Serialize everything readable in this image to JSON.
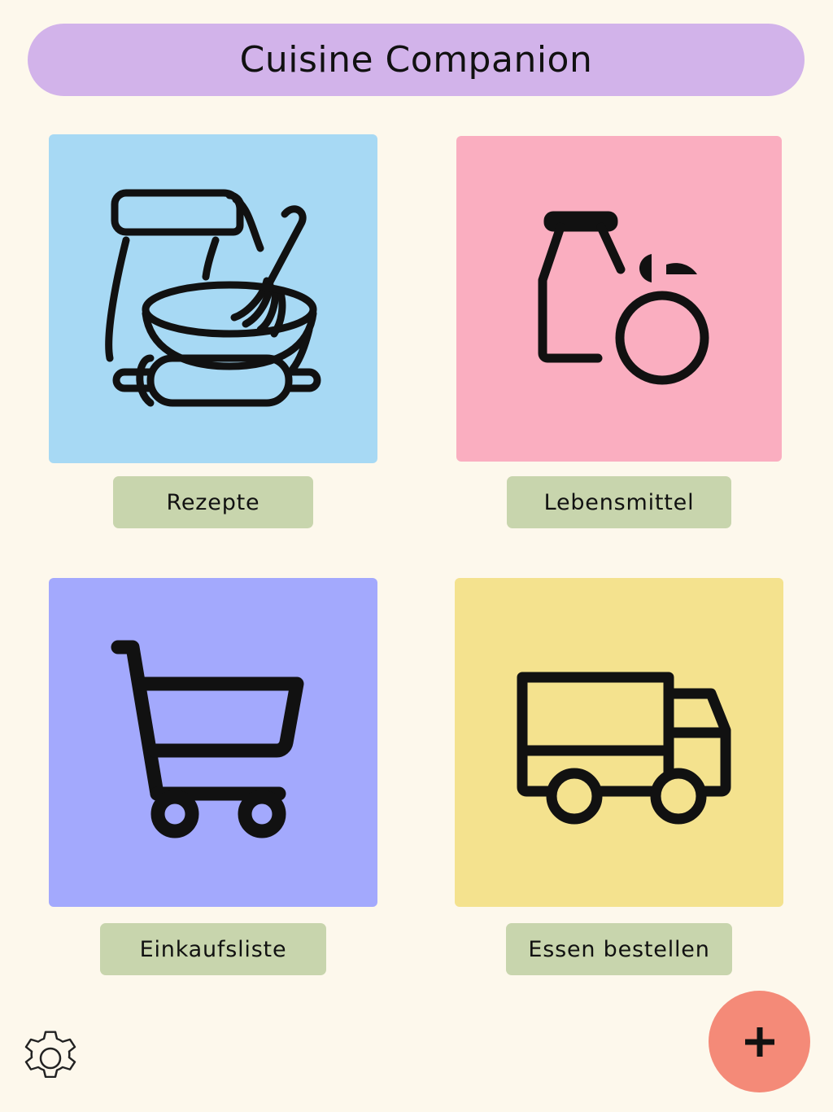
{
  "header": {
    "title": "Cuisine Companion"
  },
  "tiles": [
    {
      "label": "Rezepte",
      "icon": "baking-icon",
      "color": "#a7d9f4"
    },
    {
      "label": "Lebensmittel",
      "icon": "groceries-icon",
      "color": "#faaec0"
    },
    {
      "label": "Einkaufsliste",
      "icon": "shopping-cart-icon",
      "color": "#a3a9fd"
    },
    {
      "label": "Essen bestellen",
      "icon": "delivery-truck-icon",
      "color": "#f4e28e"
    }
  ],
  "footer": {
    "settings_icon": "gear-icon",
    "add_icon": "plus-icon",
    "add_color": "#f48a78",
    "label_color": "#c8d5ad",
    "header_color": "#d2b3ea"
  }
}
